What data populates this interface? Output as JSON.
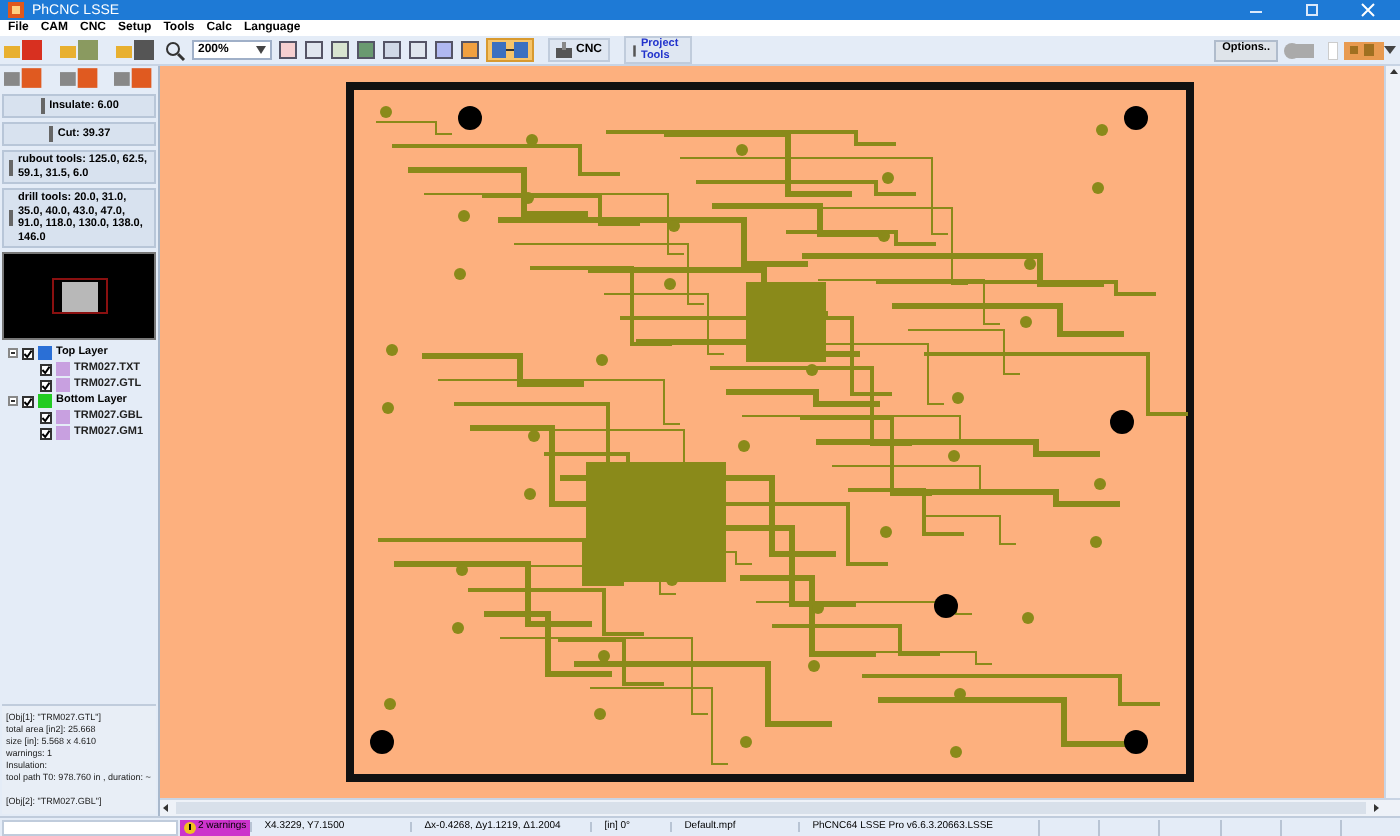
{
  "window": {
    "title": "PhCNC LSSE"
  },
  "menu": [
    "File",
    "CAM",
    "CNC",
    "Setup",
    "Tools",
    "Calc",
    "Language"
  ],
  "toolbar": {
    "zoom": "200%",
    "cnc_label": "CNC",
    "project_tools_label": "Project Tools",
    "options_label": "Options.."
  },
  "tool_buttons": [
    {
      "label": "Insulate: 6.00"
    },
    {
      "label": "Cut: 39.37"
    },
    {
      "label": "rubout tools: 125.0, 62.5, 59.1, 31.5, 6.0"
    },
    {
      "label": "drill tools: 20.0, 31.0, 35.0, 40.0, 43.0, 47.0, 91.0, 118.0, 130.0, 138.0, 146.0"
    }
  ],
  "layers": [
    {
      "label": "Top Layer",
      "checked": true,
      "expanded": true,
      "color": "#2a6fd6",
      "children": [
        {
          "label": "TRM027.TXT",
          "checked": true
        },
        {
          "label": "TRM027.GTL",
          "checked": true
        }
      ]
    },
    {
      "label": "Bottom Layer",
      "checked": true,
      "expanded": true,
      "color": "#22cc22",
      "children": [
        {
          "label": "TRM027.GBL",
          "checked": true
        },
        {
          "label": "TRM027.GM1",
          "checked": true
        }
      ]
    }
  ],
  "info_blocks": [
    [
      "[Obj[1]: \"TRM027.GTL\"]",
      "total area [in2]: 25.668",
      "size [in]: 5.568 x 4.610",
      "warnings: 1",
      "Insulation:",
      "tool path T0: 978.760 in , duration: ~"
    ],
    [
      "[Obj[2]: \"TRM027.GBL\"]"
    ]
  ],
  "status_bar": {
    "warnings": "2 warnings",
    "coords": "X4.3229, Y7.1500",
    "delta": "Δx-0.4268, Δy1.1219, Δ1.2004",
    "unit": "[in]  0°",
    "file": "Default.mpf",
    "version": "PhCNC64 LSSE Pro v6.6.3.20663.LSSE"
  }
}
